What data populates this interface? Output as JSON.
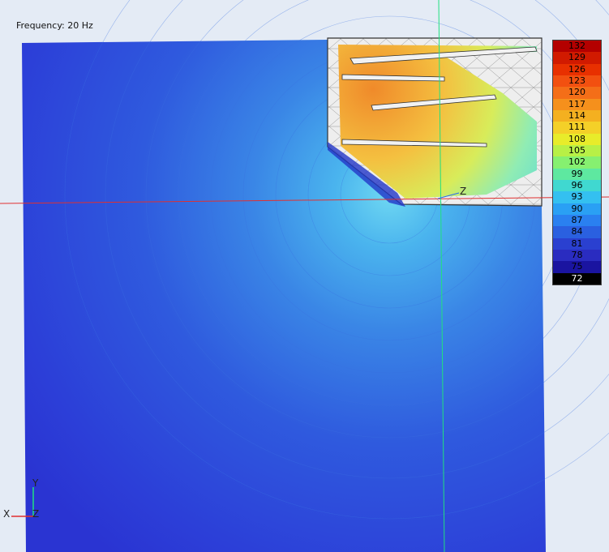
{
  "frequency_label": "Frequency: 20 Hz",
  "legend": {
    "values": [
      "132",
      "129",
      "126",
      "123",
      "120",
      "117",
      "114",
      "111",
      "108",
      "105",
      "102",
      "99",
      "96",
      "93",
      "90",
      "87",
      "84",
      "81",
      "78",
      "75",
      "72"
    ],
    "colors": [
      "#b40000",
      "#d11a00",
      "#e83000",
      "#f25010",
      "#f46e18",
      "#f5901c",
      "#f4b020",
      "#f4d028",
      "#e8ec2a",
      "#b8f046",
      "#86f070",
      "#5ee8a0",
      "#40d8d0",
      "#34c0f0",
      "#2aa0f4",
      "#2a80f0",
      "#2a60e0",
      "#2a40d0",
      "#2a2cc0",
      "#1a14a0",
      "#000000"
    ]
  },
  "axes": {
    "inset": {
      "x": "X",
      "y": "Y",
      "z": "Z"
    },
    "scene_z": "Z"
  },
  "colors": {
    "field_outer": "#2c37d9",
    "field_center": "#58c0ec",
    "cavity_hot": "#f0952c",
    "cavity_warm": "#f4cb44",
    "mouth": "#8ce6c4",
    "red_axis": "#e03030",
    "green_axis": "#20e080",
    "mesh": "#555555"
  }
}
